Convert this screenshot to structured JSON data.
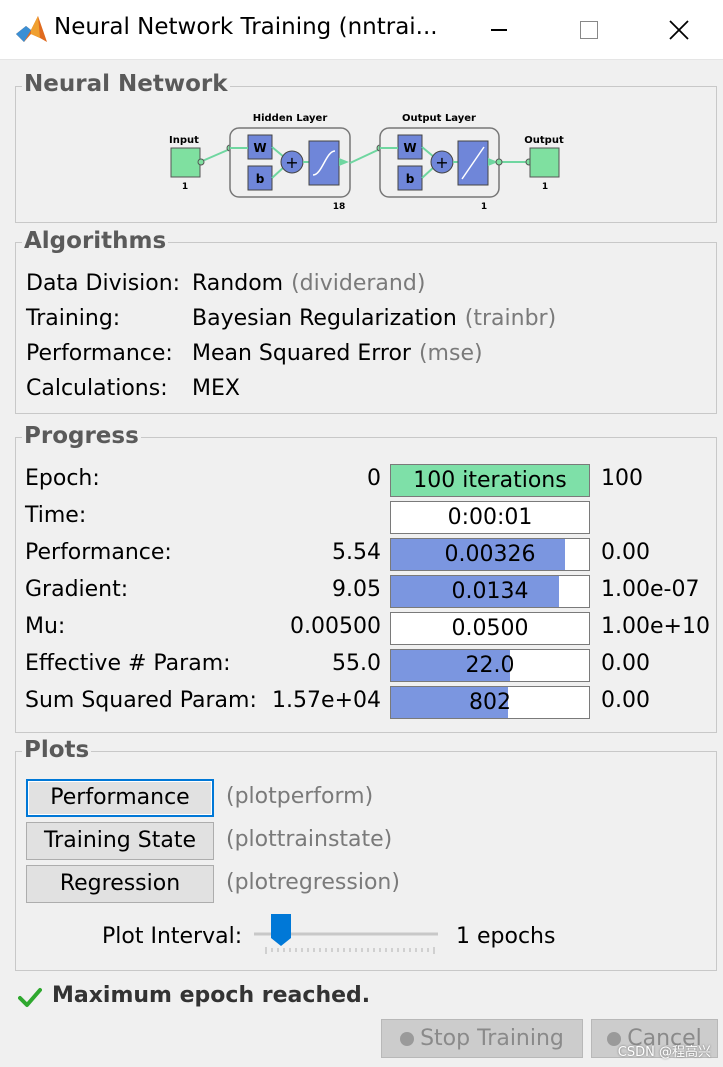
{
  "window": {
    "title": "Neural Network Training (nntrai...",
    "controls": [
      "minimize",
      "maximize",
      "close"
    ]
  },
  "neural_network": {
    "title": "Neural Network",
    "input_label": "Input",
    "input_size": "1",
    "hidden_label": "Hidden Layer",
    "hidden_size": "18",
    "output_layer_label": "Output Layer",
    "output_layer_size": "1",
    "output_label": "Output",
    "output_size": "1",
    "weight_label": "W",
    "bias_label": "b",
    "plus": "+"
  },
  "algorithms": {
    "title": "Algorithms",
    "rows": [
      {
        "label": "Data Division:",
        "value": "Random",
        "func": "(dividerand)"
      },
      {
        "label": "Training:",
        "value": "Bayesian Regularization",
        "func": "(trainbr)"
      },
      {
        "label": "Performance:",
        "value": "Mean Squared Error",
        "func": "(mse)"
      },
      {
        "label": "Calculations:",
        "value": "MEX",
        "func": ""
      }
    ]
  },
  "progress": {
    "title": "Progress",
    "rows": [
      {
        "label": "Epoch:",
        "start": "0",
        "current": "100 iterations",
        "end": "100",
        "fill": 1.0,
        "color": "#7ee0a8"
      },
      {
        "label": "Time:",
        "start": "",
        "current": "0:00:01",
        "end": "",
        "fill": 0,
        "color": "#7b96e0"
      },
      {
        "label": "Performance:",
        "start": "5.54",
        "current": "0.00326",
        "end": "0.00",
        "fill": 0.88,
        "color": "#7b96e0"
      },
      {
        "label": "Gradient:",
        "start": "9.05",
        "current": "0.0134",
        "end": "1.00e-07",
        "fill": 0.85,
        "color": "#7b96e0"
      },
      {
        "label": "Mu:",
        "start": "0.00500",
        "current": "0.0500",
        "end": "1.00e+10",
        "fill": 0,
        "color": "#7b96e0"
      },
      {
        "label": "Effective # Param:",
        "start": "55.0",
        "current": "22.0",
        "end": "0.00",
        "fill": 0.6,
        "color": "#7b96e0"
      },
      {
        "label": "Sum Squared Param:",
        "start": "1.57e+04",
        "current": "802",
        "end": "0.00",
        "fill": 0.59,
        "color": "#7b96e0"
      }
    ]
  },
  "plots": {
    "title": "Plots",
    "buttons": [
      {
        "label": "Performance",
        "func": "(plotperform)"
      },
      {
        "label": "Training State",
        "func": "(plottrainstate)"
      },
      {
        "label": "Regression",
        "func": "(plotregression)"
      }
    ],
    "interval_label": "Plot Interval:",
    "interval_value": "1 epochs",
    "interval_fraction": 0.0
  },
  "status": {
    "icon": "check-icon",
    "text": "Maximum epoch reached."
  },
  "footer": {
    "stop_label": "Stop Training",
    "cancel_label": "Cancel"
  },
  "watermark": "CSDN @程高兴",
  "colors": {
    "epoch_fill": "#7ee0a8",
    "progress_fill": "#7b96e0",
    "layer_box": "#6f86d9",
    "io_box": "#7fe0a0",
    "focus": "#0078d7",
    "check": "#2fa82f"
  }
}
